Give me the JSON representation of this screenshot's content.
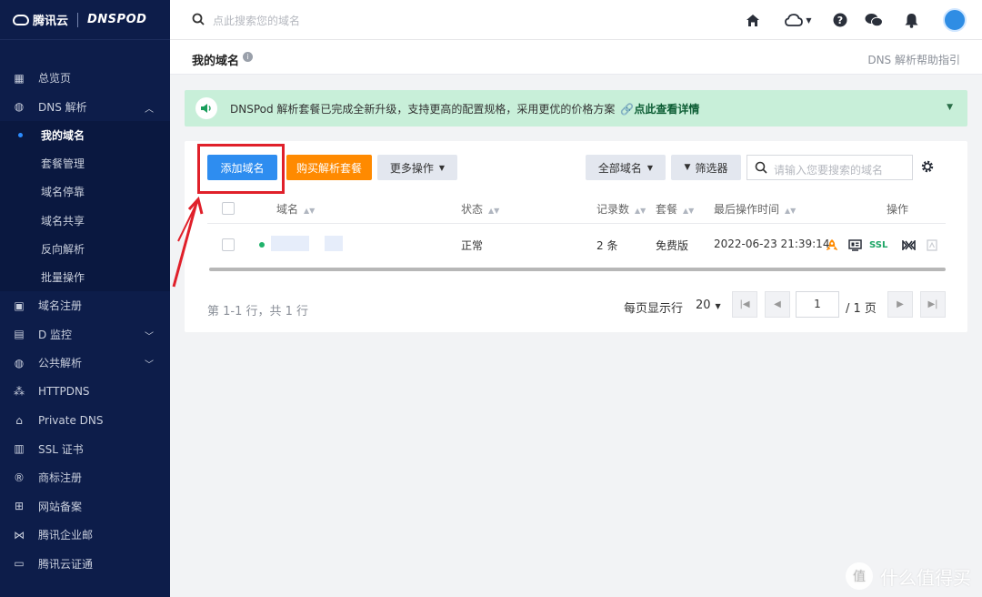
{
  "brand": {
    "name": "腾讯云",
    "product": "DNSPOD"
  },
  "search": {
    "placeholder": "点此搜索您的域名"
  },
  "sidebar": {
    "items": [
      {
        "label": "总览页",
        "icon": "grid-icon"
      },
      {
        "label": "DNS 解析",
        "icon": "globe-icon",
        "expanded": true
      },
      {
        "label": "域名注册",
        "icon": "calendar-icon"
      },
      {
        "label": "D 监控",
        "icon": "monitor-icon"
      },
      {
        "label": "公共解析",
        "icon": "globe-icon"
      },
      {
        "label": "HTTPDNS",
        "icon": "network-icon"
      },
      {
        "label": "Private DNS",
        "icon": "home-lock-icon"
      },
      {
        "label": "SSL 证书",
        "icon": "certificate-icon"
      },
      {
        "label": "商标注册",
        "icon": "registered-icon"
      },
      {
        "label": "网站备案",
        "icon": "record-icon"
      },
      {
        "label": "腾讯企业邮",
        "icon": "mail-icon"
      },
      {
        "label": "腾讯云证通",
        "icon": "id-card-icon"
      }
    ],
    "sub_items": [
      "我的域名",
      "套餐管理",
      "域名停靠",
      "域名共享",
      "反向解析",
      "批量操作"
    ],
    "active_sub": "我的域名"
  },
  "header": {
    "title": "我的域名",
    "help": "DNS 解析帮助指引"
  },
  "banner": {
    "text": "DNSPod 解析套餐已完成全新升级，支持更高的配置规格，采用更优的价格方案",
    "link": "点此查看详情"
  },
  "toolbar": {
    "add_domain": "添加域名",
    "buy_plan": "购买解析套餐",
    "more_ops": "更多操作",
    "all_domains": "全部域名",
    "filter": "筛选器",
    "search_placeholder": "请输入您要搜索的域名"
  },
  "table": {
    "headers": {
      "domain": "域名",
      "status": "状态",
      "records": "记录数",
      "plan": "套餐",
      "last_op": "最后操作时间",
      "ops": "操作"
    },
    "rows": [
      {
        "status": "正常",
        "records": "2 条",
        "plan": "免费版",
        "last_op": "2022-06-23 21:39:14",
        "ssl": "SSL"
      }
    ]
  },
  "pager": {
    "total": "第 1-1 行，共 1 行",
    "page_size_label": "每页显示行",
    "page_size": "20",
    "current_page": "1",
    "total_pages": "/ 1 页"
  },
  "watermark": "什么值得买",
  "colors": {
    "sidebar": "#0d1d4a",
    "primary": "#2e8df0",
    "orange": "#ff8a00",
    "banner": "#c8efd9",
    "highlight": "#e0202a"
  }
}
